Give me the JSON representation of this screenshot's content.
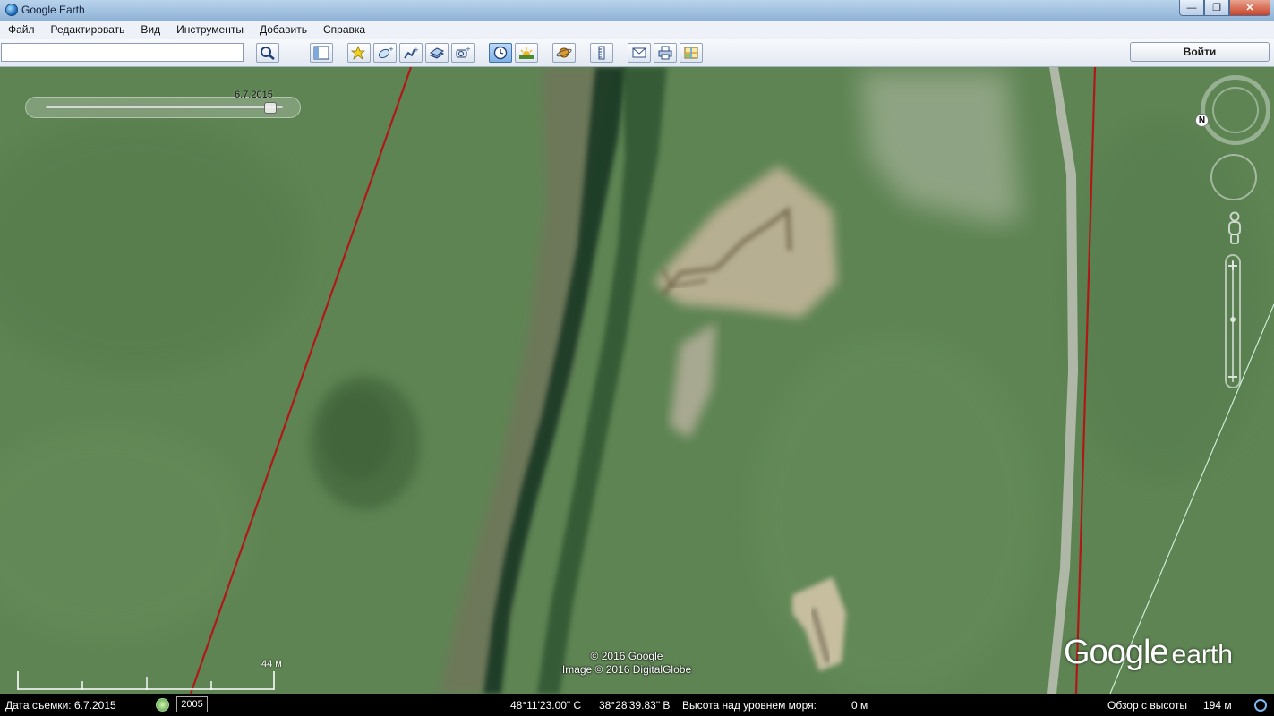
{
  "window": {
    "title": "Google Earth",
    "minimize": "—",
    "maximize": "❐",
    "close": "✕"
  },
  "menu": [
    "Файл",
    "Редактировать",
    "Вид",
    "Инструменты",
    "Добавить",
    "Справка"
  ],
  "search": {
    "value": "",
    "placeholder": ""
  },
  "toolbar_icons": [
    "sidebar-icon",
    "placemark-icon",
    "polygon-icon",
    "path-icon",
    "image-overlay-icon",
    "record-tour-icon",
    "historical-imagery-icon",
    "sunlight-icon",
    "planet-icon",
    "ruler-icon",
    "email-icon",
    "print-icon",
    "google-maps-icon"
  ],
  "login_label": "Войти",
  "time_slider": {
    "date_label": "6.7.2015",
    "position_fraction": 0.97
  },
  "attribution": [
    "© 2016 Google",
    "Image © 2016 DigitalGlobe"
  ],
  "logo": {
    "word1": "Google",
    "word2": "earth"
  },
  "scale": {
    "label": "44 м"
  },
  "navigation": {
    "north": "N"
  },
  "status": {
    "capture_date": "Дата съемки: 6.7.2015",
    "year": "2005",
    "latitude": "48°11'23.00\" С",
    "longitude": "38°28'39.83\" В",
    "elevation_label": "Высота над уровнем моря:",
    "elevation_value": "0 м",
    "eye_alt_label": "Обзор с высоты",
    "eye_alt_value": "194 м"
  },
  "colors": {
    "accent": "#3e73ad",
    "border_line": "#b01818",
    "grass": "#5f8454"
  }
}
